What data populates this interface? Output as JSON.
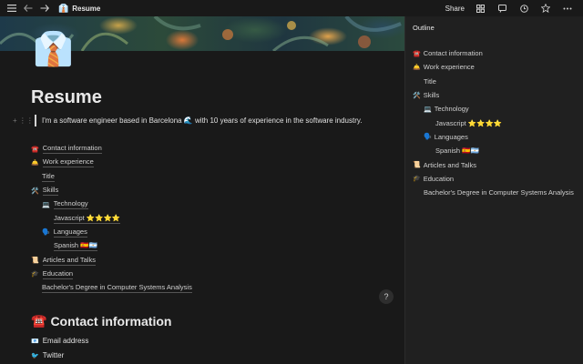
{
  "topbar": {
    "page_emoji": "👔",
    "page_title": "Resume",
    "share_label": "Share"
  },
  "page": {
    "cover_emoji": "👔",
    "title": "Resume",
    "intro": "I'm a software engineer based in Barcelona 🌊 with 10 years of experience in the software industry.",
    "toc": [
      {
        "emoji": "☎️",
        "label": "Contact information",
        "level": 0
      },
      {
        "emoji": "🛎️",
        "label": "Work experience",
        "level": 0
      },
      {
        "emoji": "",
        "label": "Title",
        "level": 1
      },
      {
        "emoji": "🛠️",
        "label": "Skills",
        "level": 0
      },
      {
        "emoji": "💻",
        "label": "Technology",
        "level": 1
      },
      {
        "emoji": "",
        "label": "Javascript ⭐⭐⭐⭐",
        "level": 2
      },
      {
        "emoji": "🗣️",
        "label": "Languages",
        "level": 1
      },
      {
        "emoji": "",
        "label": "Spanish 🇪🇸🇦🇷",
        "level": 2
      },
      {
        "emoji": "📜",
        "label": "Articles and Talks",
        "level": 0
      },
      {
        "emoji": "🎓",
        "label": "Education",
        "level": 0
      },
      {
        "emoji": "",
        "label": "Bachelor's Degree in Computer Systems Analysis",
        "level": 1
      }
    ],
    "section_heading": {
      "emoji": "☎️",
      "label": "Contact information"
    },
    "email": {
      "emoji": "📧",
      "label": "Email address"
    },
    "twitter": {
      "emoji": "🐦",
      "label": "Twitter"
    },
    "help_label": "?"
  },
  "outline": {
    "title": "Outline",
    "items": [
      {
        "emoji": "☎️",
        "label": "Contact information",
        "level": 0
      },
      {
        "emoji": "🛎️",
        "label": "Work experience",
        "level": 0
      },
      {
        "emoji": "",
        "label": "Title",
        "level": 1
      },
      {
        "emoji": "🛠️",
        "label": "Skills",
        "level": 0
      },
      {
        "emoji": "💻",
        "label": "Technology",
        "level": 1
      },
      {
        "emoji": "",
        "label": "Javascript ⭐⭐⭐⭐",
        "level": 2
      },
      {
        "emoji": "🗣️",
        "label": "Languages",
        "level": 1
      },
      {
        "emoji": "",
        "label": "Spanish 🇪🇸🇦🇷",
        "level": 2
      },
      {
        "emoji": "📜",
        "label": "Articles and Talks",
        "level": 0
      },
      {
        "emoji": "🎓",
        "label": "Education",
        "level": 0
      },
      {
        "emoji": "",
        "label": "Bachelor's Degree in Computer Systems Analysis",
        "level": 1
      }
    ]
  }
}
